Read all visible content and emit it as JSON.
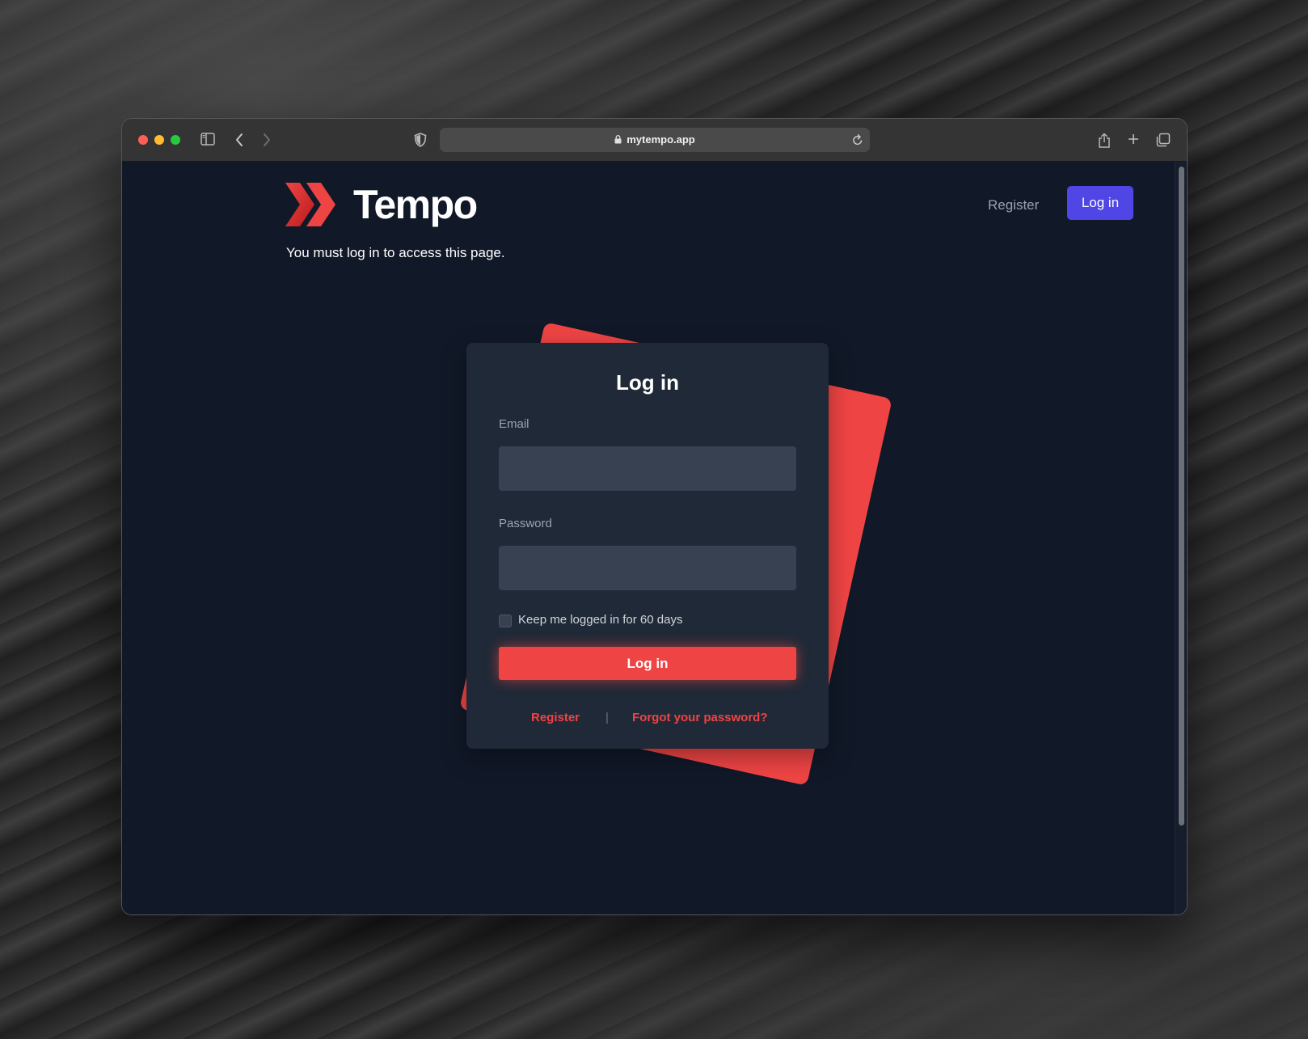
{
  "browser": {
    "url": "mytempo.app",
    "icons": {
      "sidebar": "sidebar-icon",
      "back": "chevron-left-icon",
      "forward": "chevron-right-icon",
      "privacy": "shield-icon",
      "lock": "lock-icon",
      "reload": "reload-icon",
      "share": "share-icon",
      "new_tab": "plus-icon",
      "tabs": "tabs-overview-icon"
    }
  },
  "header": {
    "logo_text": "Tempo",
    "nav": {
      "register": "Register",
      "login": "Log in"
    }
  },
  "notice": "You must log in to access this page.",
  "login_form": {
    "title": "Log in",
    "email_label": "Email",
    "email_value": "",
    "password_label": "Password",
    "password_value": "",
    "remember_label": "Keep me logged in for 60 days",
    "remember_checked": false,
    "submit_label": "Log in",
    "register_link": "Register",
    "divider": "|",
    "forgot_link": "Forgot your password?"
  },
  "colors": {
    "accent_red": "#ef4444",
    "nav_button": "#4f46e5",
    "page_bg": "#111827",
    "card_bg": "#1f2937",
    "input_bg": "#374151"
  }
}
